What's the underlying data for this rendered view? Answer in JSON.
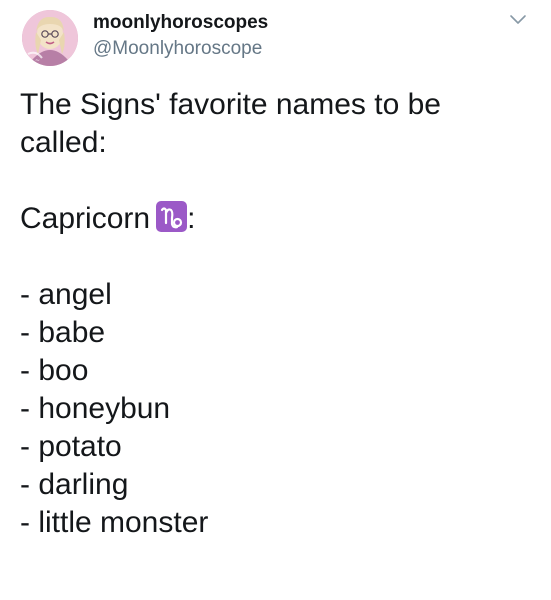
{
  "account": {
    "display_name": "moonlyhoroscopes",
    "handle": "@Moonlyhoroscope",
    "avatar_icon": "avatar-girl-pink-icon"
  },
  "tweet": {
    "intro_line_1": "The Signs' favorite names to be",
    "intro_line_2": "called:",
    "sign_name": "Capricorn",
    "sign_icon": "capricorn-zodiac-icon",
    "sign_suffix": ":",
    "names": [
      "- angel",
      "- babe",
      "- boo",
      "- honeybun",
      "- potato",
      "- darling",
      "- little monster"
    ]
  },
  "colors": {
    "text": "#14171a",
    "handle": "#657786",
    "zodiac_badge": "#9b59c7"
  },
  "menu_icon": "chevron-down-icon"
}
